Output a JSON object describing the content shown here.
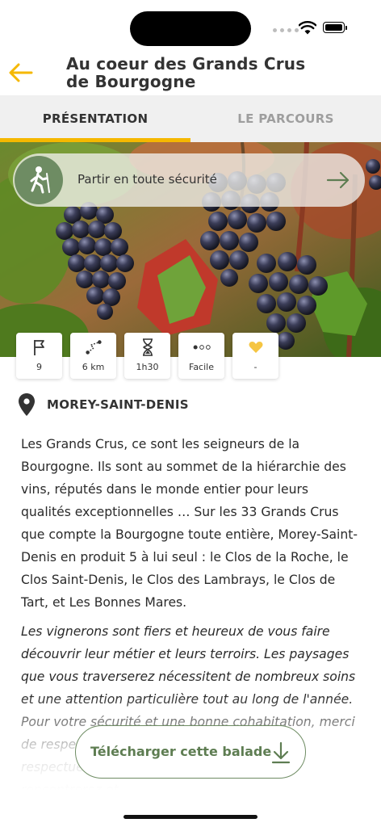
{
  "header": {
    "title_line1": "Au coeur des Grands Crus",
    "title_line2": "de Bourgogne"
  },
  "tabs": [
    {
      "label": "PRÉSENTATION",
      "active": true
    },
    {
      "label": "LE PARCOURS",
      "active": false
    }
  ],
  "safety": {
    "label": "Partir en toute sécurité",
    "icon": "hiker-icon"
  },
  "stats": [
    {
      "icon": "flag-icon",
      "value": "9"
    },
    {
      "icon": "route-icon",
      "value": "6 km"
    },
    {
      "icon": "hourglass-icon",
      "value": "1h30"
    },
    {
      "icon": "difficulty-dots-icon",
      "value": "Facile"
    },
    {
      "icon": "heart-icon",
      "value": "-"
    }
  ],
  "location": {
    "label": "MOREY-SAINT-DENIS"
  },
  "description": {
    "p1": "Les Grands Crus, ce sont les seigneurs de la Bourgogne. Ils sont au sommet de la hiérarchie des vins, réputés dans le monde entier pour leurs qualités exceptionnelles … Sur les 33 Grands Crus que compte la Bourgogne toute entière, Morey-Saint-Denis en produit 5 à lui seul : le Clos de la Roche, le Clos Saint-Denis, le Clos des Lambrays, le Clos de Tart, et Les Bonnes Mares.",
    "p2": "Les vignerons sont fiers et heureux de vous faire découvrir leur métier et leurs terroirs. Les paysages que vous traverserez nécessitent de nombreux soins et une attention particulière tout au long de l'année. Pour votre sécurité et une bonne cohabitation, merci de respecter l'intimité des engins et d'être respectueux envers les personnes que vous rencontrerez et"
  },
  "download": {
    "label": "Télécharger cette balade"
  },
  "colors": {
    "accent": "#f5b800",
    "green": "#6e8c63",
    "text": "#333333"
  }
}
